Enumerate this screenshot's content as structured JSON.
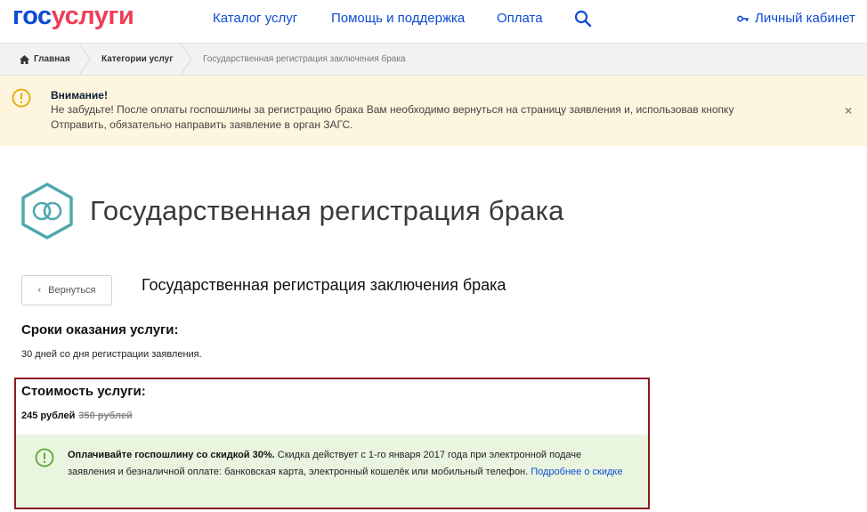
{
  "header": {
    "logo_gos": "гос",
    "logo_uslugi": "услуги",
    "nav": [
      "Каталог услуг",
      "Помощь и поддержка",
      "Оплата"
    ],
    "cabinet_label": "Личный кабинет"
  },
  "breadcrumb": {
    "home": "Главная",
    "categories": "Категории услуг",
    "current": "Государственная регистрация заключения брака"
  },
  "alert": {
    "title": "Внимание!",
    "text": "Не забудьте! После оплаты госпошлины за регистрацию брака Вам необходимо вернуться на страницу заявления и, использовав кнопку Отправить, обязательно направить заявление в орган ЗАГС.",
    "close": "×"
  },
  "page": {
    "title": "Государственная регистрация брака",
    "back_label": "Вернуться",
    "subtitle": "Государственная регистрация заключения брака"
  },
  "terms": {
    "heading": "Сроки оказания услуги:",
    "text": "30 дней со дня регистрации заявления."
  },
  "cost": {
    "heading": "Стоимость услуги:",
    "price": "245 рублей",
    "old_price": "350 рублей",
    "discount_bold": "Оплачивайте госпошлину со скидкой 30%.",
    "discount_text": " Скидка действует с 1-го января 2017 года при электронной подаче заявления и безналичной оплате: банковская карта, электронный кошелёк или мобильный телефон. ",
    "discount_link": "Подробнее о скидке"
  },
  "colors": {
    "brand_blue": "#0d4cd3",
    "brand_red": "#ee3f58",
    "teal": "#4fa8ae",
    "alert_bg": "#fdf5dd",
    "discount_bg": "#e9f5df",
    "box_border": "#8b1a22"
  }
}
